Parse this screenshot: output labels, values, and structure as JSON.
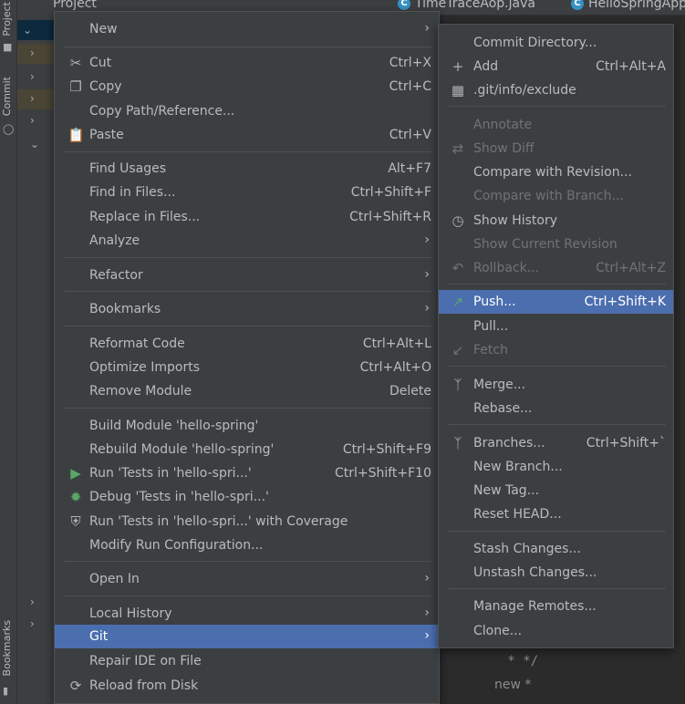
{
  "tool_windows": {
    "project": "Project",
    "commit": "Commit",
    "bookmarks": "Bookmarks"
  },
  "tabs": [
    {
      "label": "Project"
    },
    {
      "label": "TimeTraceAop.java"
    },
    {
      "label": "HelloSpringApp"
    }
  ],
  "editor_fragments": {
    "line1": " * */",
    "line2": "new *"
  },
  "context_menu": {
    "items": [
      {
        "label": "New",
        "submenu": true
      },
      {
        "label": "Cut",
        "shortcut": "Ctrl+X",
        "icon": "scissors-icon"
      },
      {
        "label": "Copy",
        "shortcut": "Ctrl+C",
        "icon": "copy-icon"
      },
      {
        "label": "Copy Path/Reference..."
      },
      {
        "label": "Paste",
        "shortcut": "Ctrl+V",
        "icon": "paste-icon"
      },
      {
        "label": "Find Usages",
        "shortcut": "Alt+F7"
      },
      {
        "label": "Find in Files...",
        "shortcut": "Ctrl+Shift+F"
      },
      {
        "label": "Replace in Files...",
        "shortcut": "Ctrl+Shift+R"
      },
      {
        "label": "Analyze",
        "submenu": true
      },
      {
        "label": "Refactor",
        "submenu": true
      },
      {
        "label": "Bookmarks",
        "submenu": true
      },
      {
        "label": "Reformat Code",
        "shortcut": "Ctrl+Alt+L"
      },
      {
        "label": "Optimize Imports",
        "shortcut": "Ctrl+Alt+O"
      },
      {
        "label": "Remove Module",
        "shortcut": "Delete"
      },
      {
        "label": "Build Module 'hello-spring'"
      },
      {
        "label": "Rebuild Module 'hello-spring'",
        "shortcut": "Ctrl+Shift+F9"
      },
      {
        "label": "Run 'Tests in 'hello-spri...'",
        "shortcut": "Ctrl+Shift+F10",
        "icon": "run-icon"
      },
      {
        "label": "Debug 'Tests in 'hello-spri...'",
        "icon": "debug-icon"
      },
      {
        "label": "Run 'Tests in 'hello-spri...' with Coverage",
        "icon": "coverage-icon"
      },
      {
        "label": "Modify Run Configuration..."
      },
      {
        "label": "Open In",
        "submenu": true
      },
      {
        "label": "Local History",
        "submenu": true
      },
      {
        "label": "Git",
        "submenu": true,
        "selected": true
      },
      {
        "label": "Repair IDE on File"
      },
      {
        "label": "Reload from Disk",
        "icon": "reload-icon"
      }
    ]
  },
  "git_menu": {
    "items": [
      {
        "label": "Commit Directory..."
      },
      {
        "label": "Add",
        "shortcut": "Ctrl+Alt+A",
        "icon": "plus-icon"
      },
      {
        "label": ".git/info/exclude",
        "icon": "git-file-icon"
      },
      {
        "label": "Annotate",
        "disabled": true
      },
      {
        "label": "Show Diff",
        "disabled": true,
        "icon": "diff-icon"
      },
      {
        "label": "Compare with Revision..."
      },
      {
        "label": "Compare with Branch...",
        "disabled": true
      },
      {
        "label": "Show History",
        "icon": "history-icon"
      },
      {
        "label": "Show Current Revision",
        "disabled": true
      },
      {
        "label": "Rollback...",
        "shortcut": "Ctrl+Alt+Z",
        "disabled": true,
        "icon": "rollback-icon"
      },
      {
        "label": "Push...",
        "shortcut": "Ctrl+Shift+K",
        "selected": true,
        "icon": "push-icon"
      },
      {
        "label": "Pull..."
      },
      {
        "label": "Fetch",
        "disabled": true,
        "icon": "fetch-icon"
      },
      {
        "label": "Merge...",
        "icon": "merge-icon"
      },
      {
        "label": "Rebase..."
      },
      {
        "label": "Branches...",
        "shortcut": "Ctrl+Shift+`",
        "icon": "branch-icon"
      },
      {
        "label": "New Branch..."
      },
      {
        "label": "New Tag..."
      },
      {
        "label": "Reset HEAD..."
      },
      {
        "label": "Stash Changes..."
      },
      {
        "label": "Unstash Changes..."
      },
      {
        "label": "Manage Remotes..."
      },
      {
        "label": "Clone..."
      }
    ]
  },
  "colors": {
    "menu_bg": "#3c3f41",
    "selection": "#4b6eaf",
    "text": "#bbbbbb",
    "disabled": "#727272"
  }
}
